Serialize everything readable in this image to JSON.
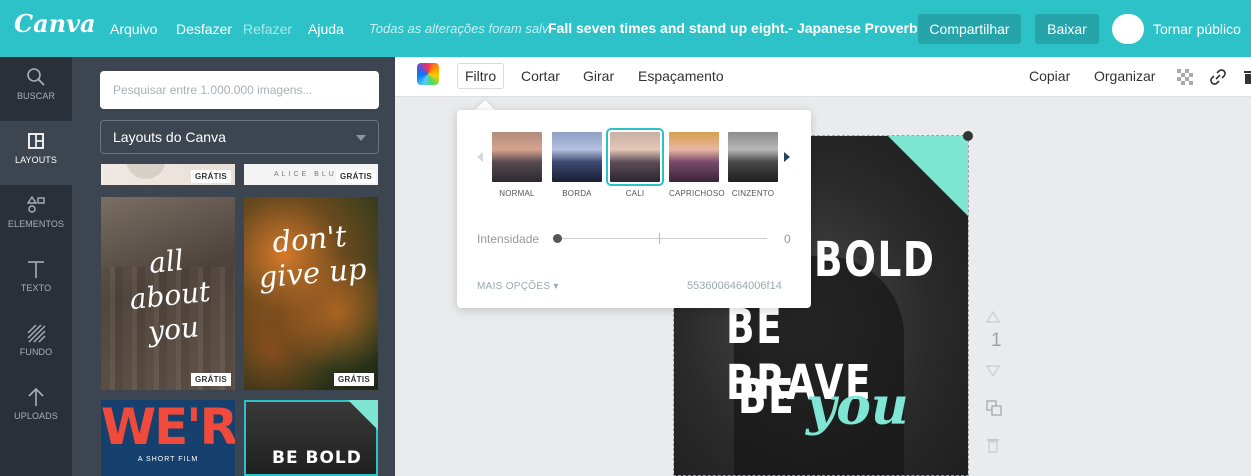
{
  "topbar": {
    "logo": "Canva",
    "menu": {
      "file": "Arquivo",
      "undo": "Desfazer",
      "redo": "Refazer",
      "help": "Ajuda"
    },
    "status": "Todas as alterações foram salvas",
    "document_title": "Fall seven times and stand up eight.- Japanese Proverb",
    "share_label": "Compartilhar",
    "download_label": "Baixar",
    "public_label": "Tornar público"
  },
  "rail": [
    {
      "label": "BUSCAR",
      "icon": "search-icon"
    },
    {
      "label": "LAYOUTS",
      "icon": "layouts-icon"
    },
    {
      "label": "ELEMENTOS",
      "icon": "elements-icon"
    },
    {
      "label": "TEXTO",
      "icon": "text-icon"
    },
    {
      "label": "FUNDO",
      "icon": "background-icon"
    },
    {
      "label": "UPLOADS",
      "icon": "upload-icon"
    }
  ],
  "panel": {
    "search_placeholder": "Pesquisar entre 1.000.000 imagens...",
    "layout_select": "Layouts do Canva",
    "badge_free": "GRÁTIS",
    "thumb_alice": "ALICE BLU",
    "thumb1_text": "all about you",
    "thumb2_text": "don't give up",
    "thumb3_text": "WE'RE",
    "thumb3_sub": "A SHORT FILM",
    "thumb4_text": "BE BOLD"
  },
  "toolbar": {
    "filter": "Filtro",
    "crop": "Cortar",
    "rotate": "Girar",
    "spacing": "Espaçamento",
    "copy": "Copiar",
    "arrange": "Organizar"
  },
  "filter_popup": {
    "filters": [
      {
        "label": "NORMAL"
      },
      {
        "label": "BORDA"
      },
      {
        "label": "CALI",
        "selected": true
      },
      {
        "label": "CAPRICHOSO"
      },
      {
        "label": "CINZENTO"
      }
    ],
    "intensity_label": "Intensidade",
    "intensity_value": "0",
    "more_options": "MAIS OPÇÕES",
    "filter_code": "5536006464006f14"
  },
  "canvas": {
    "line1": "BOLD",
    "line2": "BE BRAVE",
    "line3": "BE",
    "line3_script": "you",
    "page_number": "1"
  },
  "colors": {
    "brand": "#2cc2c8",
    "rail": "#293039",
    "panel": "#3c4550",
    "accent_mint": "#7fe6d4"
  }
}
